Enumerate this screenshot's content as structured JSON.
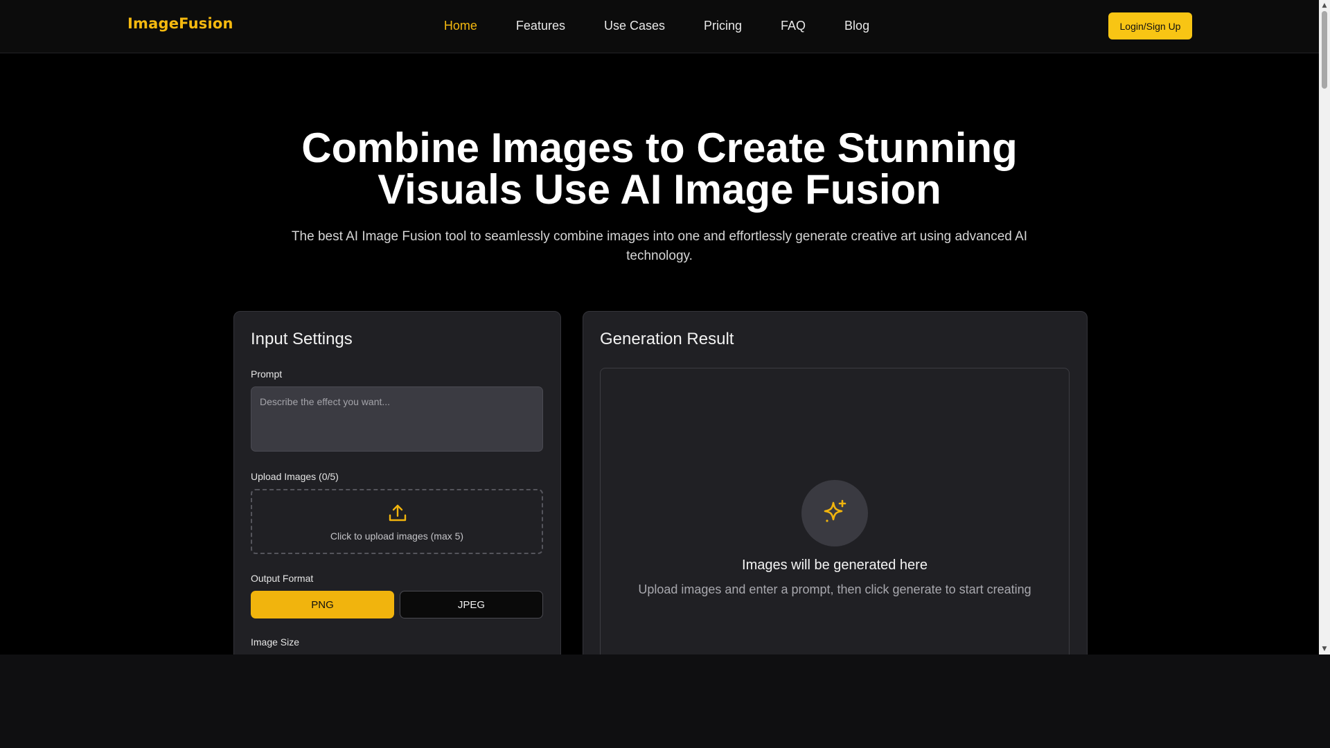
{
  "header": {
    "logo": "ImageFusion",
    "nav": [
      {
        "label": "Home",
        "active": true
      },
      {
        "label": "Features",
        "active": false
      },
      {
        "label": "Use Cases",
        "active": false
      },
      {
        "label": "Pricing",
        "active": false
      },
      {
        "label": "FAQ",
        "active": false
      },
      {
        "label": "Blog",
        "active": false
      }
    ],
    "login_label": "Login/Sign Up"
  },
  "hero": {
    "title_line1": "Combine Images to Create Stunning",
    "title_line2": "Visuals Use AI Image Fusion",
    "subtitle": "The best AI Image Fusion tool to seamlessly combine images into one and effortlessly generate creative art using advanced AI technology."
  },
  "input_settings": {
    "title": "Input Settings",
    "prompt_label": "Prompt",
    "prompt_placeholder": "Describe the effect you want...",
    "prompt_value": "",
    "upload_label": "Upload Images (0/5)",
    "upload_hint": "Click to upload images (max 5)",
    "upload_icon": "upload-icon",
    "output_format_label": "Output Format",
    "formats": [
      {
        "label": "PNG",
        "selected": true
      },
      {
        "label": "JPEG",
        "selected": false
      }
    ],
    "image_size_label": "Image Size"
  },
  "generation_result": {
    "title": "Generation Result",
    "icon": "sparkle-icon",
    "heading": "Images will be generated here",
    "description": "Upload images and enter a prompt, then click generate to start creating"
  },
  "theme": {
    "accent": "#f5b90f",
    "button_accent": "#f8c514",
    "background": "#000000",
    "card": "#202024"
  }
}
